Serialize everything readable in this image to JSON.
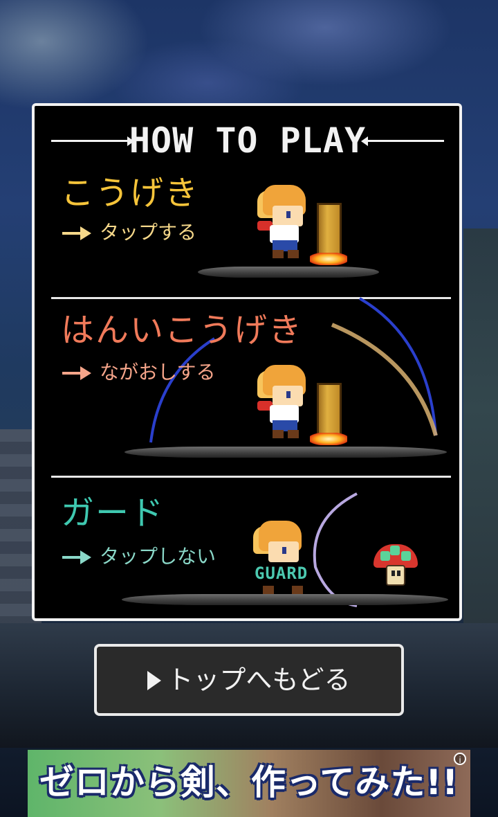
{
  "title": "HOW TO PLAY",
  "sections": [
    {
      "title": "こうげき",
      "subtitle": "タップする",
      "color": "#f6c43a"
    },
    {
      "title": "はんいこうげき",
      "subtitle": "ながおしする",
      "color": "#f07a5a"
    },
    {
      "title": "ガード",
      "subtitle": "タップしない",
      "color": "#3fc8b0"
    }
  ],
  "guard_label": "GUARD",
  "back_button": "トップへもどる",
  "ad": {
    "text": "ゼロから剣、作ってみた!!",
    "info_icon": "i"
  }
}
